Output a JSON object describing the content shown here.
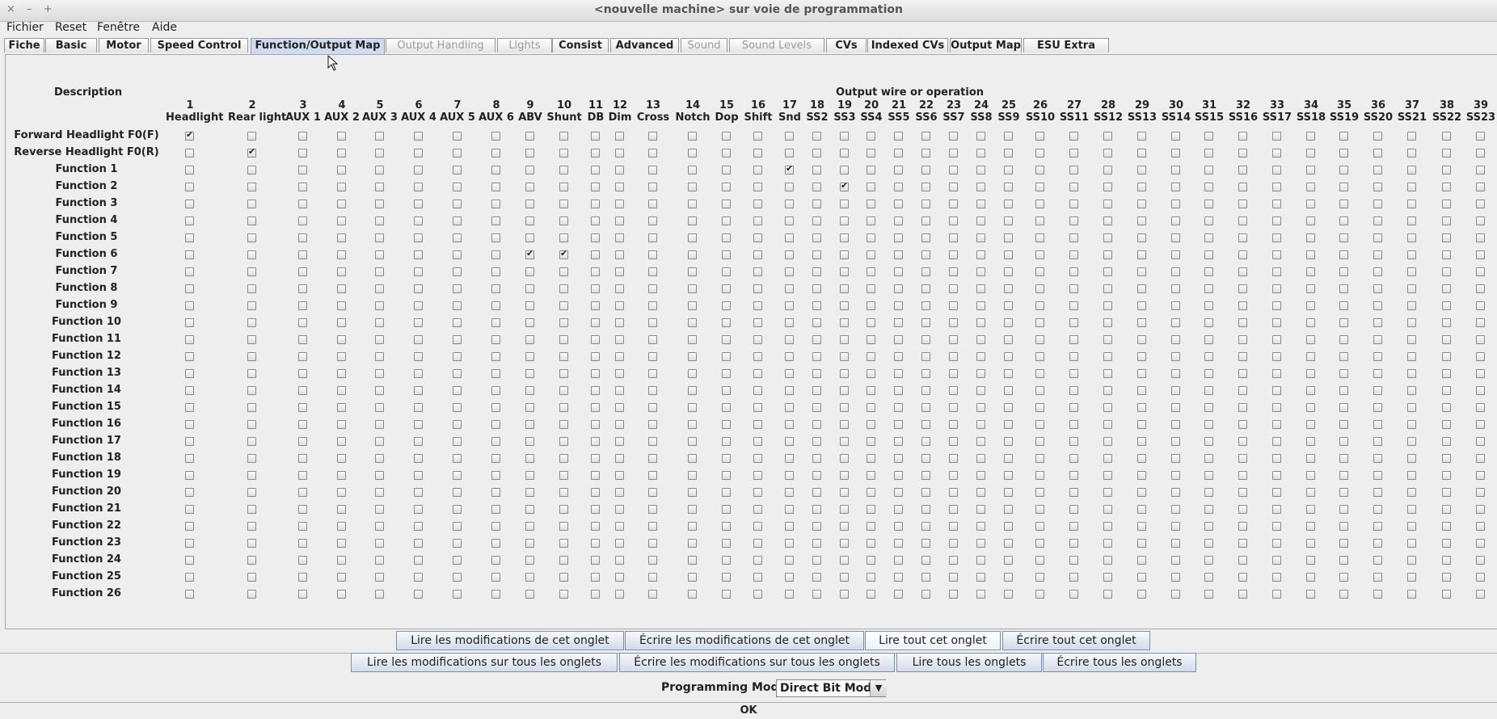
{
  "window": {
    "title": "<nouvelle machine> sur voie de programmation",
    "controls": [
      "×",
      "–",
      "+"
    ]
  },
  "menu": [
    "Fichier",
    "Reset",
    "Fenêtre",
    "Aide"
  ],
  "tabs": [
    {
      "label": "Fiche",
      "state": "normal"
    },
    {
      "label": "Basic",
      "state": "normal"
    },
    {
      "label": "Motor",
      "state": "normal"
    },
    {
      "label": "Speed Control",
      "state": "normal"
    },
    {
      "label": "Function/Output Map",
      "state": "selected"
    },
    {
      "label": "Output Handling",
      "state": "disabled"
    },
    {
      "label": "Lights",
      "state": "disabled"
    },
    {
      "label": "Consist",
      "state": "normal"
    },
    {
      "label": "Advanced",
      "state": "normal"
    },
    {
      "label": "Sound",
      "state": "disabled"
    },
    {
      "label": "Sound Levels",
      "state": "disabled"
    },
    {
      "label": "CVs",
      "state": "normal"
    },
    {
      "label": "Indexed CVs",
      "state": "normal"
    },
    {
      "label": "Output Map",
      "state": "normal"
    },
    {
      "label": "ESU Extra",
      "state": "normal"
    }
  ],
  "grid": {
    "description_header": "Description",
    "output_header": "Output wire or operation",
    "columns": [
      {
        "num": "1",
        "name": "Headlight"
      },
      {
        "num": "2",
        "name": "Rear light"
      },
      {
        "num": "3",
        "name": "AUX 1"
      },
      {
        "num": "4",
        "name": "AUX 2"
      },
      {
        "num": "5",
        "name": "AUX 3"
      },
      {
        "num": "6",
        "name": "AUX 4"
      },
      {
        "num": "7",
        "name": "AUX 5"
      },
      {
        "num": "8",
        "name": "AUX 6"
      },
      {
        "num": "9",
        "name": "ABV"
      },
      {
        "num": "10",
        "name": "Shunt"
      },
      {
        "num": "11",
        "name": "DB"
      },
      {
        "num": "12",
        "name": "Dim"
      },
      {
        "num": "13",
        "name": "Cross"
      },
      {
        "num": "14",
        "name": "Notch"
      },
      {
        "num": "15",
        "name": "Dop"
      },
      {
        "num": "16",
        "name": "Shift"
      },
      {
        "num": "17",
        "name": "Snd"
      },
      {
        "num": "18",
        "name": "SS2"
      },
      {
        "num": "19",
        "name": "SS3"
      },
      {
        "num": "20",
        "name": "SS4"
      },
      {
        "num": "21",
        "name": "SS5"
      },
      {
        "num": "22",
        "name": "SS6"
      },
      {
        "num": "23",
        "name": "SS7"
      },
      {
        "num": "24",
        "name": "SS8"
      },
      {
        "num": "25",
        "name": "SS9"
      },
      {
        "num": "26",
        "name": "SS10"
      },
      {
        "num": "27",
        "name": "SS11"
      },
      {
        "num": "28",
        "name": "SS12"
      },
      {
        "num": "29",
        "name": "SS13"
      },
      {
        "num": "30",
        "name": "SS14"
      },
      {
        "num": "31",
        "name": "SS15"
      },
      {
        "num": "32",
        "name": "SS16"
      },
      {
        "num": "33",
        "name": "SS17"
      },
      {
        "num": "34",
        "name": "SS18"
      },
      {
        "num": "35",
        "name": "SS19"
      },
      {
        "num": "36",
        "name": "SS20"
      },
      {
        "num": "37",
        "name": "SS21"
      },
      {
        "num": "38",
        "name": "SS22"
      },
      {
        "num": "39",
        "name": "SS23"
      }
    ],
    "rows": [
      {
        "label": "Forward Headlight F0(F)",
        "checked": [
          1
        ]
      },
      {
        "label": "Reverse Headlight F0(R)",
        "checked": [
          2
        ]
      },
      {
        "label": "Function 1",
        "checked": [
          17
        ]
      },
      {
        "label": "Function 2",
        "checked": [
          19
        ]
      },
      {
        "label": "Function 3",
        "checked": []
      },
      {
        "label": "Function 4",
        "checked": []
      },
      {
        "label": "Function 5",
        "checked": []
      },
      {
        "label": "Function 6",
        "checked": [
          9,
          10
        ]
      },
      {
        "label": "Function 7",
        "checked": []
      },
      {
        "label": "Function 8",
        "checked": []
      },
      {
        "label": "Function 9",
        "checked": []
      },
      {
        "label": "Function 10",
        "checked": []
      },
      {
        "label": "Function 11",
        "checked": []
      },
      {
        "label": "Function 12",
        "checked": []
      },
      {
        "label": "Function 13",
        "checked": []
      },
      {
        "label": "Function 14",
        "checked": []
      },
      {
        "label": "Function 15",
        "checked": []
      },
      {
        "label": "Function 16",
        "checked": []
      },
      {
        "label": "Function 17",
        "checked": []
      },
      {
        "label": "Function 18",
        "checked": []
      },
      {
        "label": "Function 19",
        "checked": []
      },
      {
        "label": "Function 20",
        "checked": []
      },
      {
        "label": "Function 21",
        "checked": []
      },
      {
        "label": "Function 22",
        "checked": []
      },
      {
        "label": "Function 23",
        "checked": []
      },
      {
        "label": "Function 24",
        "checked": []
      },
      {
        "label": "Function 25",
        "checked": []
      },
      {
        "label": "Function 26",
        "checked": []
      }
    ]
  },
  "tab_buttons": {
    "read_changes": "Lire les modifications de cet onglet",
    "write_changes": "Écrire les modifications de cet onglet",
    "read_all": "Lire tout cet onglet",
    "write_all": "Écrire tout cet onglet"
  },
  "global_buttons": {
    "read_changes_all": "Lire les modifications sur tous les onglets",
    "write_changes_all": "Écrire les modifications sur tous les onglets",
    "read_all_tabs": "Lire tous les onglets",
    "write_all_tabs": "Écrire tous les onglets"
  },
  "programming": {
    "label": "Programming Mode",
    "selected": "Direct Bit Mode",
    "arrow_icon": "chevron-down-icon"
  },
  "ok_label": "OK"
}
